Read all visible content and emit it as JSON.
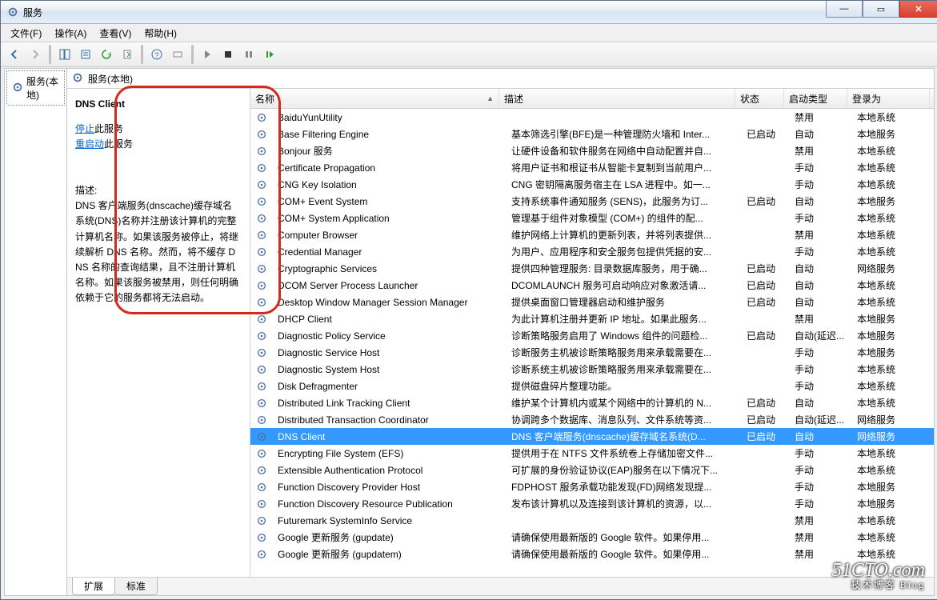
{
  "window": {
    "title": "服务"
  },
  "winbuttons": {
    "min": "—",
    "max": "▭",
    "close": "✕"
  },
  "menu": {
    "file": "文件(F)",
    "action": "操作(A)",
    "view": "查看(V)",
    "help": "帮助(H)"
  },
  "tree": {
    "root_label": "服务(本地)"
  },
  "main_header": {
    "label": "服务(本地)"
  },
  "detail": {
    "title": "DNS Client",
    "stop_link": "停止",
    "stop_suffix": "此服务",
    "restart_link": "重启动",
    "restart_suffix": "此服务",
    "desc_label": "描述:",
    "desc": "DNS 客户端服务(dnscache)缓存域名系统(DNS)名称并注册该计算机的完整计算机名称。如果该服务被停止，将继续解析 DNS 名称。然而，将不缓存 DNS 名称的查询结果，且不注册计算机名称。如果该服务被禁用，则任何明确依赖于它的服务都将无法启动。"
  },
  "columns": {
    "name": "名称",
    "desc": "描述",
    "status": "状态",
    "startup": "启动类型",
    "logon": "登录为"
  },
  "tabs": {
    "ext": "扩展",
    "std": "标准"
  },
  "watermark": {
    "main": "51CTO.com",
    "sub": "技术博客  Blog"
  },
  "rows": [
    {
      "name": "BaiduYunUtility",
      "desc": "",
      "status": "",
      "startup": "禁用",
      "logon": "本地系统"
    },
    {
      "name": "Base Filtering Engine",
      "desc": "基本筛选引擎(BFE)是一种管理防火墙和 Inter...",
      "status": "已启动",
      "startup": "自动",
      "logon": "本地服务"
    },
    {
      "name": "Bonjour 服务",
      "desc": "让硬件设备和软件服务在网络中自动配置并自...",
      "status": "",
      "startup": "禁用",
      "logon": "本地系统"
    },
    {
      "name": "Certificate Propagation",
      "desc": "将用户证书和根证书从智能卡复制到当前用户...",
      "status": "",
      "startup": "手动",
      "logon": "本地系统"
    },
    {
      "name": "CNG Key Isolation",
      "desc": "CNG 密钥隔离服务宿主在 LSA 进程中。如一...",
      "status": "",
      "startup": "手动",
      "logon": "本地系统"
    },
    {
      "name": "COM+ Event System",
      "desc": "支持系统事件通知服务 (SENS)，此服务为订...",
      "status": "已启动",
      "startup": "自动",
      "logon": "本地服务"
    },
    {
      "name": "COM+ System Application",
      "desc": "管理基于组件对象模型 (COM+) 的组件的配...",
      "status": "",
      "startup": "手动",
      "logon": "本地系统"
    },
    {
      "name": "Computer Browser",
      "desc": "维护网络上计算机的更新列表，并将列表提供...",
      "status": "",
      "startup": "禁用",
      "logon": "本地系统"
    },
    {
      "name": "Credential Manager",
      "desc": "为用户、应用程序和安全服务包提供凭据的安...",
      "status": "",
      "startup": "手动",
      "logon": "本地系统"
    },
    {
      "name": "Cryptographic Services",
      "desc": "提供四种管理服务: 目录数据库服务，用于确...",
      "status": "已启动",
      "startup": "自动",
      "logon": "网络服务"
    },
    {
      "name": "DCOM Server Process Launcher",
      "desc": "DCOMLAUNCH 服务可启动响应对象激活请...",
      "status": "已启动",
      "startup": "自动",
      "logon": "本地系统"
    },
    {
      "name": "Desktop Window Manager Session Manager",
      "desc": "提供桌面窗口管理器启动和维护服务",
      "status": "已启动",
      "startup": "自动",
      "logon": "本地系统"
    },
    {
      "name": "DHCP Client",
      "desc": "为此计算机注册并更新 IP 地址。如果此服务...",
      "status": "",
      "startup": "禁用",
      "logon": "本地服务"
    },
    {
      "name": "Diagnostic Policy Service",
      "desc": "诊断策略服务启用了 Windows 组件的问题检...",
      "status": "已启动",
      "startup": "自动(延迟...",
      "logon": "本地服务"
    },
    {
      "name": "Diagnostic Service Host",
      "desc": "诊断服务主机被诊断策略服务用来承载需要在...",
      "status": "",
      "startup": "手动",
      "logon": "本地服务"
    },
    {
      "name": "Diagnostic System Host",
      "desc": "诊断系统主机被诊断策略服务用来承载需要在...",
      "status": "",
      "startup": "手动",
      "logon": "本地系统"
    },
    {
      "name": "Disk Defragmenter",
      "desc": "提供磁盘碎片整理功能。",
      "status": "",
      "startup": "手动",
      "logon": "本地系统"
    },
    {
      "name": "Distributed Link Tracking Client",
      "desc": "维护某个计算机内或某个网络中的计算机的 N...",
      "status": "已启动",
      "startup": "自动",
      "logon": "本地系统"
    },
    {
      "name": "Distributed Transaction Coordinator",
      "desc": "协调跨多个数据库、消息队列、文件系统等资...",
      "status": "已启动",
      "startup": "自动(延迟...",
      "logon": "网络服务"
    },
    {
      "name": "DNS Client",
      "desc": "DNS 客户端服务(dnscache)缓存域名系统(D...",
      "status": "已启动",
      "startup": "自动",
      "logon": "网络服务",
      "selected": true
    },
    {
      "name": "Encrypting File System (EFS)",
      "desc": "提供用于在 NTFS 文件系统卷上存储加密文件...",
      "status": "",
      "startup": "手动",
      "logon": "本地系统"
    },
    {
      "name": "Extensible Authentication Protocol",
      "desc": "可扩展的身份验证协议(EAP)服务在以下情况下...",
      "status": "",
      "startup": "手动",
      "logon": "本地系统"
    },
    {
      "name": "Function Discovery Provider Host",
      "desc": "FDPHOST 服务承载功能发现(FD)网络发现提...",
      "status": "",
      "startup": "手动",
      "logon": "本地服务"
    },
    {
      "name": "Function Discovery Resource Publication",
      "desc": "发布该计算机以及连接到该计算机的资源，以...",
      "status": "",
      "startup": "手动",
      "logon": "本地服务"
    },
    {
      "name": "Futuremark SystemInfo Service",
      "desc": "",
      "status": "",
      "startup": "禁用",
      "logon": "本地系统"
    },
    {
      "name": "Google 更新服务 (gupdate)",
      "desc": "请确保使用最新版的 Google 软件。如果停用...",
      "status": "",
      "startup": "禁用",
      "logon": "本地系统"
    },
    {
      "name": "Google 更新服务 (gupdatem)",
      "desc": "请确保使用最新版的 Google 软件。如果停用...",
      "status": "",
      "startup": "禁用",
      "logon": "本地系统"
    }
  ]
}
